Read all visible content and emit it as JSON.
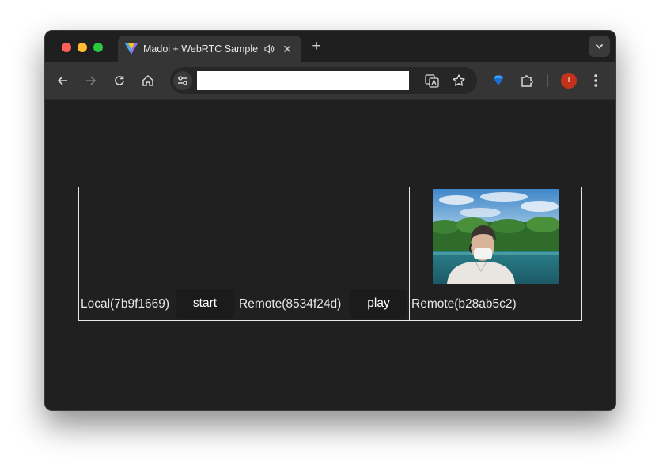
{
  "browser": {
    "tab_title": "Madoi + WebRTC Sample",
    "tab_close_glyph": "✕",
    "new_tab_glyph": "+",
    "url_value": "",
    "profile_initial": "T",
    "icons": [
      "madoi-logo-icon",
      "audio-playing-icon",
      "tab-close-icon",
      "new-tab-icon",
      "tab-search-icon",
      "back-icon",
      "forward-icon",
      "reload-icon",
      "home-icon",
      "site-info-icon",
      "translate-icon",
      "bookmark-star-icon",
      "extension-gem-icon",
      "extensions-puzzle-icon",
      "more-menu-icon"
    ]
  },
  "app": {
    "cells": [
      {
        "label": "Local(7b9f1669)",
        "button": "start"
      },
      {
        "label": "Remote(8534f24d)",
        "button": "play"
      },
      {
        "label": "Remote(b28ab5c2)"
      }
    ]
  },
  "colors": {
    "background": "#202020",
    "border": "#e8e8e8",
    "button_bg": "#1b1b1b",
    "avatar": "#c5321b"
  }
}
